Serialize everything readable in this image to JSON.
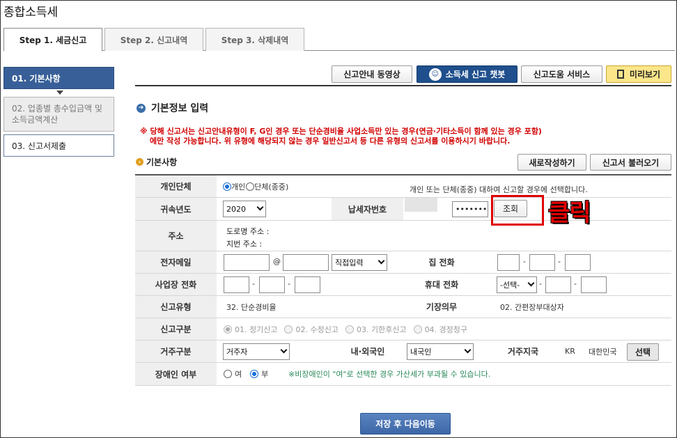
{
  "app_title": "종합소득세",
  "tabs": [
    {
      "label": "Step 1. 세금신고"
    },
    {
      "label": "Step 2. 신고내역"
    },
    {
      "label": "Step 3. 삭제내역"
    }
  ],
  "sidebar": {
    "items": [
      {
        "label": "01. 기본사항"
      },
      {
        "label": "02. 업종별 총수입금액 및 소득금액계산"
      },
      {
        "label": "03. 신고서제출"
      }
    ]
  },
  "toolbar": {
    "guide_video": "신고안내 동영상",
    "chatbot": "소득세 신고 챗봇",
    "help_service": "신고도움 서비스",
    "preview": "미리보기"
  },
  "section_title": "기본정보 입력",
  "notice_line1": "※ 당해 신고서는 신고안내유형이 F, G인 경우 또는 단순경비율 사업소득만 있는 경우(연금·기타소득이 함께 있는 경우 포함)",
  "notice_line2": "에만 작성 가능합니다. 위 유형에 해당되지 않는 경우 일반신고서 등 다른 유형의 신고서를 이용하시기 바랍니다.",
  "basic": {
    "title": "기본사항",
    "new_write": "새로작성하기",
    "load_return": "신고서 불러오기"
  },
  "form": {
    "entity_type": {
      "label": "개인단체",
      "option_individual": "개인",
      "option_group": "단체(종중)",
      "help": "개인 또는 단체(종중) 대하여 신고할 경우에 선택합니다."
    },
    "year": {
      "label": "귀속년도",
      "value": "2020"
    },
    "taxpayer_no": {
      "label": "납세자번호",
      "masked": "•••••••",
      "lookup": "조회"
    },
    "address": {
      "label": "주소",
      "road": "도로명 주소 :",
      "lot": "지번 주소 :"
    },
    "email": {
      "label": "전자메일",
      "at": "@",
      "domain_select": "직접입력"
    },
    "home_phone": {
      "label": "집 전화"
    },
    "office_phone": {
      "label": "사업장 전화"
    },
    "mobile": {
      "label": "휴대 전화",
      "select": "-선택-"
    },
    "report_type": {
      "label": "신고유형",
      "value": "32. 단순경비율"
    },
    "bookkeeping": {
      "label": "기장의무",
      "value": "02. 간편장부대상자"
    },
    "report_kind": {
      "label": "신고구분",
      "options": [
        "01. 정기신고",
        "02. 수정신고",
        "03. 기한후신고",
        "04. 경정청구"
      ]
    },
    "residence": {
      "label": "거주구분",
      "value": "거주자"
    },
    "nationality": {
      "label": "내·외국인",
      "value": "내국인"
    },
    "residence_country": {
      "label": "거주지국",
      "code": "KR",
      "name": "대한민국",
      "select": "선택"
    },
    "disabled": {
      "label": "장애인 여부",
      "yes": "여",
      "no": "부",
      "note": "※비장애인이 \"여\"로 선택한 경우 가산세가 부과될 수 있습니다."
    },
    "dash": "-"
  },
  "annotation": {
    "click_label": "클릭"
  },
  "save_next": "저장 후 다음이동",
  "colors": {
    "accent": "#385f98",
    "notice": "#d20000",
    "highlight": "#e00000"
  }
}
